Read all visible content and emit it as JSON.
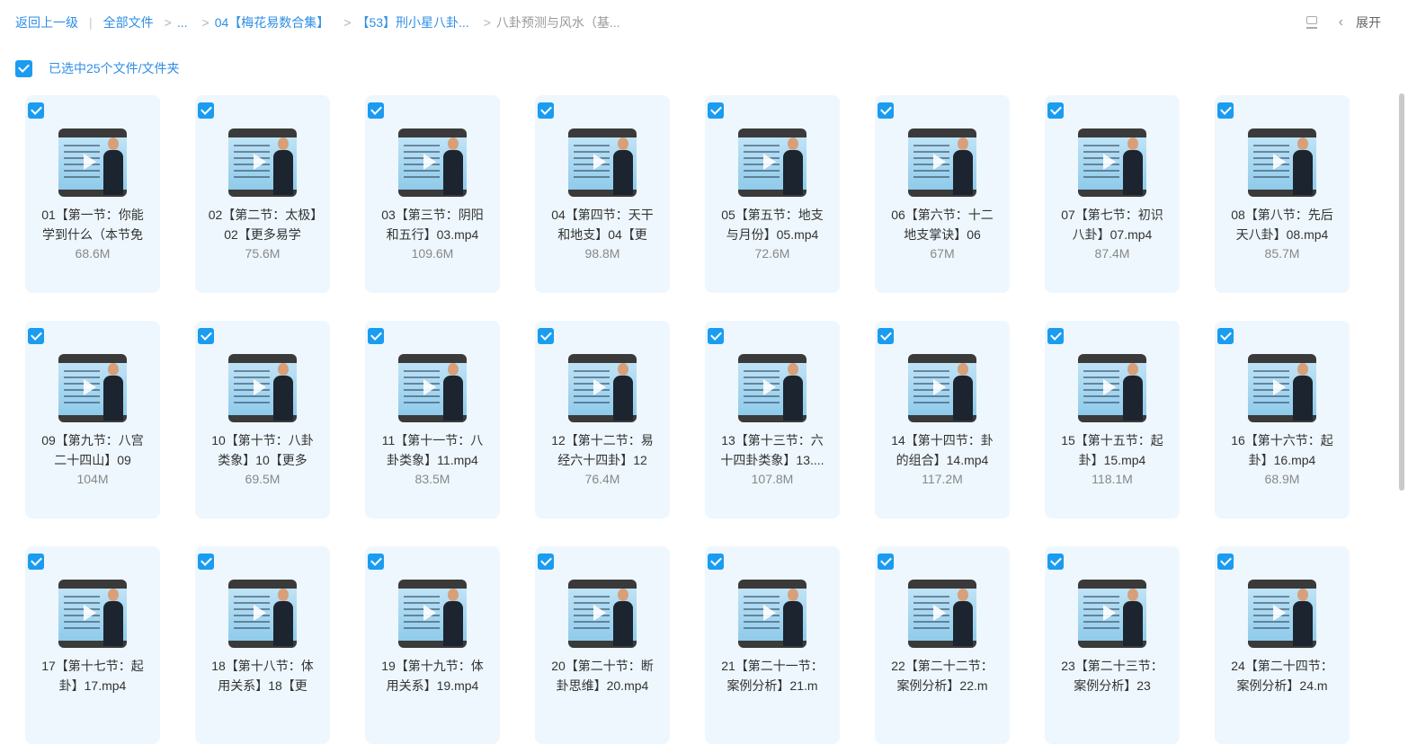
{
  "breadcrumb": {
    "back": "返回上一级",
    "items": [
      "全部文件",
      "...",
      "04【梅花易数合集】",
      "【53】刑小星八卦...",
      "八卦预测与风水（基..."
    ]
  },
  "toolbar": {
    "expand": "展开"
  },
  "selection": {
    "text": "已选中25个文件/文件夹"
  },
  "files": [
    {
      "name": "01【第一节：你能学到什么（本节免",
      "size": "68.6M"
    },
    {
      "name": "02【第二节：太极】02【更多易学",
      "size": "75.6M"
    },
    {
      "name": "03【第三节：阴阳和五行】03.mp4",
      "size": "109.6M"
    },
    {
      "name": "04【第四节：天干和地支】04【更",
      "size": "98.8M"
    },
    {
      "name": "05【第五节：地支与月份】05.mp4",
      "size": "72.6M"
    },
    {
      "name": "06【第六节：十二地支掌诀】06",
      "size": "67M"
    },
    {
      "name": "07【第七节：初识八卦】07.mp4",
      "size": "87.4M"
    },
    {
      "name": "08【第八节：先后天八卦】08.mp4",
      "size": "85.7M"
    },
    {
      "name": "09【第九节：八宫二十四山】09",
      "size": "104M"
    },
    {
      "name": "10【第十节：八卦类象】10【更多",
      "size": "69.5M"
    },
    {
      "name": "11【第十一节：八卦类象】11.mp4",
      "size": "83.5M"
    },
    {
      "name": "12【第十二节：易经六十四卦】12",
      "size": "76.4M"
    },
    {
      "name": "13【第十三节：六十四卦类象】13....",
      "size": "107.8M"
    },
    {
      "name": "14【第十四节：卦的组合】14.mp4",
      "size": "117.2M"
    },
    {
      "name": "15【第十五节：起卦】15.mp4",
      "size": "118.1M"
    },
    {
      "name": "16【第十六节：起卦】16.mp4",
      "size": "68.9M"
    },
    {
      "name": "17【第十七节：起卦】17.mp4",
      "size": ""
    },
    {
      "name": "18【第十八节：体用关系】18【更",
      "size": ""
    },
    {
      "name": "19【第十九节：体用关系】19.mp4",
      "size": ""
    },
    {
      "name": "20【第二十节：断卦思维】20.mp4",
      "size": ""
    },
    {
      "name": "21【第二十一节：案例分析】21.m",
      "size": ""
    },
    {
      "name": "22【第二十二节：案例分析】22.m",
      "size": ""
    },
    {
      "name": "23【第二十三节：案例分析】23",
      "size": ""
    },
    {
      "name": "24【第二十四节：案例分析】24.m",
      "size": ""
    }
  ]
}
